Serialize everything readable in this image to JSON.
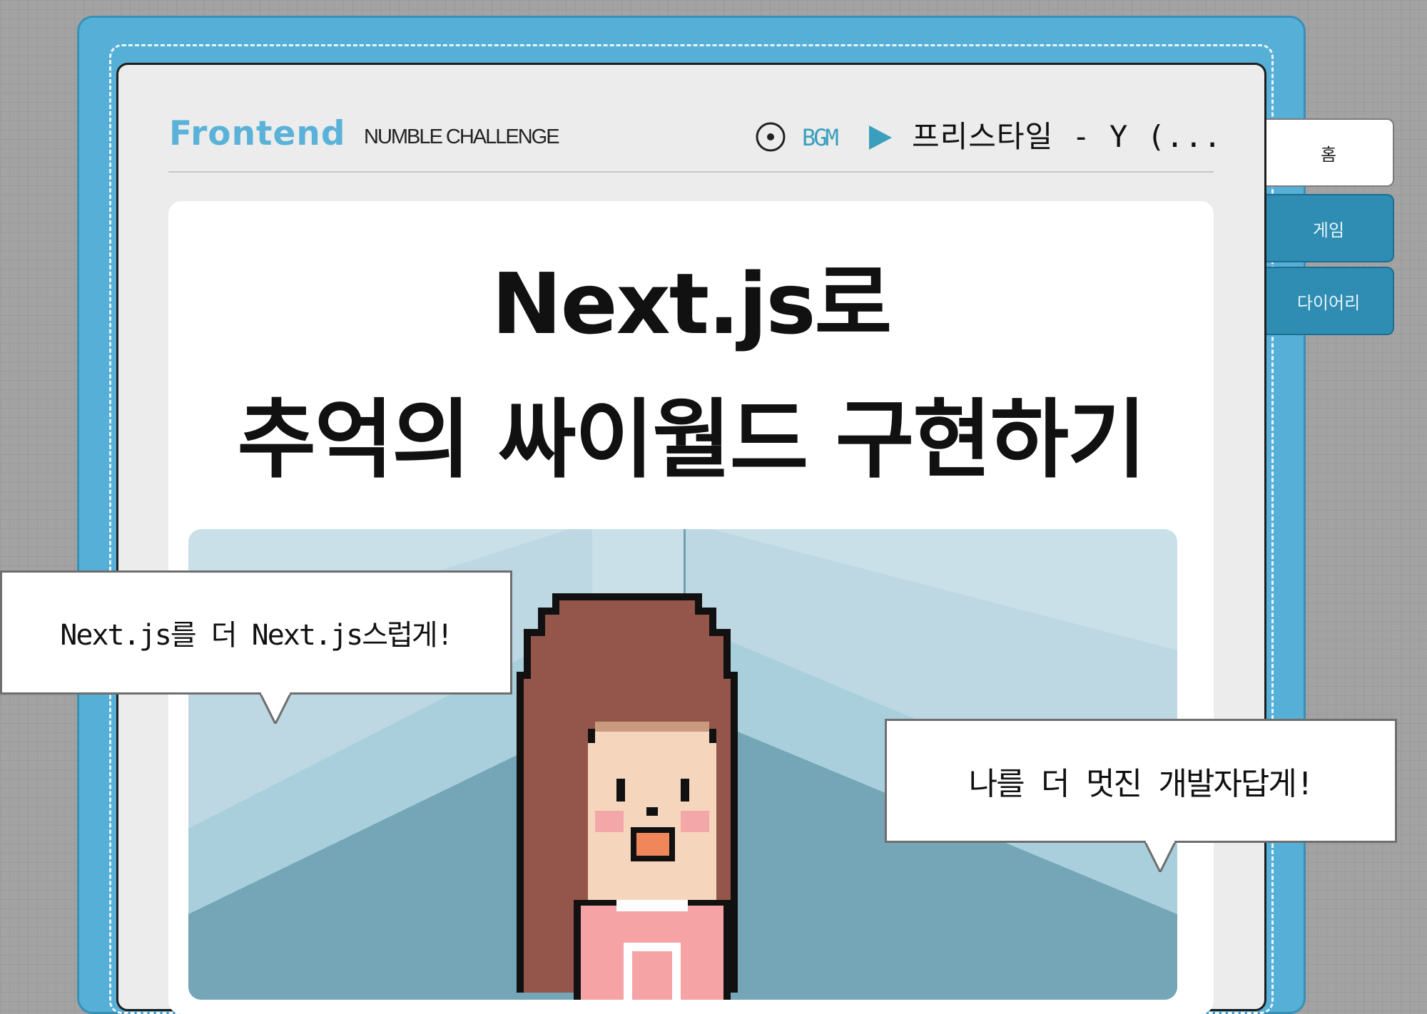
{
  "header": {
    "brand": "Frontend",
    "subtitle": "NUMBLE CHALLENGE",
    "bgm_label": "BGM",
    "track_title": "프리스타일 - Y (...",
    "icons": [
      "disc-icon",
      "play-icon"
    ]
  },
  "hero": {
    "title_line1": "Next.js로",
    "title_line2": "추억의 싸이월드 구현하기"
  },
  "bubbles": {
    "left": "Next.js를 더 Next.js스럽게!",
    "right": "나를 더 멋진 개발자답게!"
  },
  "nav": {
    "tabs": [
      {
        "label": "홈",
        "active": true
      },
      {
        "label": "게임",
        "active": false
      },
      {
        "label": "다이어리",
        "active": false
      }
    ]
  },
  "colors": {
    "frame": "#56afd6",
    "accent": "#5ab2d8",
    "tab_active": "#ffffff",
    "tab_inactive": "#2f8db3",
    "hair": "#94564a",
    "skin": "#f5d6bd",
    "shirt": "#f5a3a4"
  }
}
